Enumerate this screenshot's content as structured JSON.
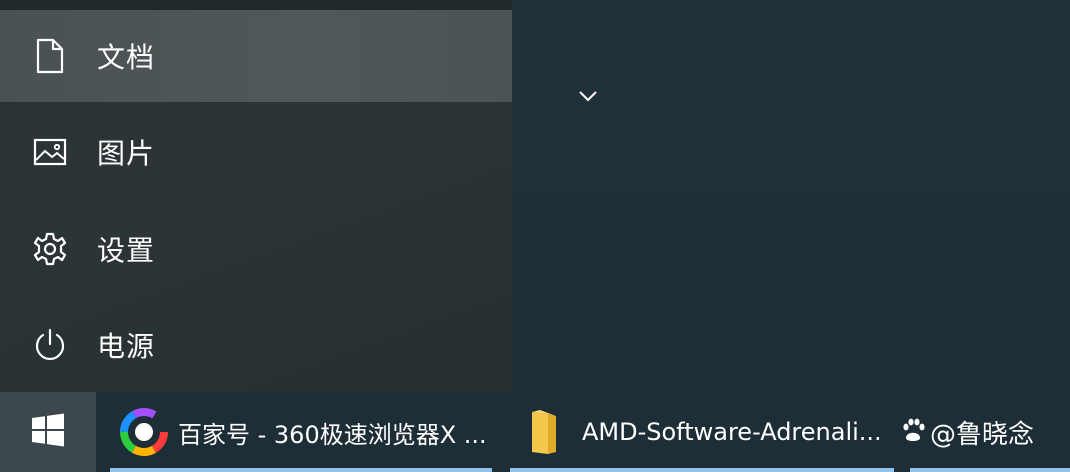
{
  "start_menu": {
    "items": [
      {
        "label": "文档",
        "icon": "document-icon"
      },
      {
        "label": "图片",
        "icon": "pictures-icon"
      },
      {
        "label": "设置",
        "icon": "gear-icon"
      },
      {
        "label": "电源",
        "icon": "power-icon"
      }
    ],
    "expand_icon": "chevron-down-icon"
  },
  "taskbar": {
    "start_icon": "windows-logo-icon",
    "tasks": [
      {
        "label": "百家号 - 360极速浏览器X ...",
        "icon": "browser-360-icon"
      },
      {
        "label": "AMD-Software-Adrenali...",
        "icon": "folder-icon"
      }
    ],
    "active_color": "#8fc3ea"
  },
  "watermark": {
    "text": "@鲁晓念",
    "icon": "paw-icon"
  }
}
